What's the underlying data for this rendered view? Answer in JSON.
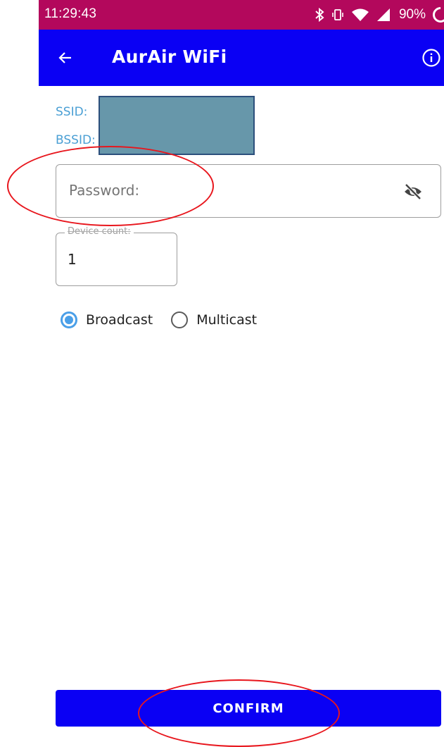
{
  "status_bar": {
    "time": "11:29:43",
    "battery": "90%",
    "icons": [
      "bluetooth-icon",
      "vibrate-icon",
      "wifi-icon",
      "cell-signal-icon",
      "battery-icon"
    ]
  },
  "app_bar": {
    "title": "AurAir WiFi",
    "background_color": "#0a00f4",
    "back_icon": "arrow-left-icon",
    "info_icon": "info-icon"
  },
  "network_info": {
    "ssid_label": "SSID:",
    "bssid_label": "BSSID:"
  },
  "password_field": {
    "placeholder": "Password:",
    "value": "",
    "visibility_icon": "eye-off-icon"
  },
  "device_count": {
    "label": "Device count:",
    "value": "1"
  },
  "mode": {
    "options": [
      {
        "label": "Broadcast",
        "selected": true
      },
      {
        "label": "Multicast",
        "selected": false
      }
    ]
  },
  "confirm_button": {
    "label": "CONFIRM"
  },
  "colors": {
    "status_bar": "#b3085c",
    "accent": "#0a00f4",
    "link": "#4a9fd4",
    "radio_selected": "#4a9fe8",
    "annotation": "#e8161d"
  }
}
